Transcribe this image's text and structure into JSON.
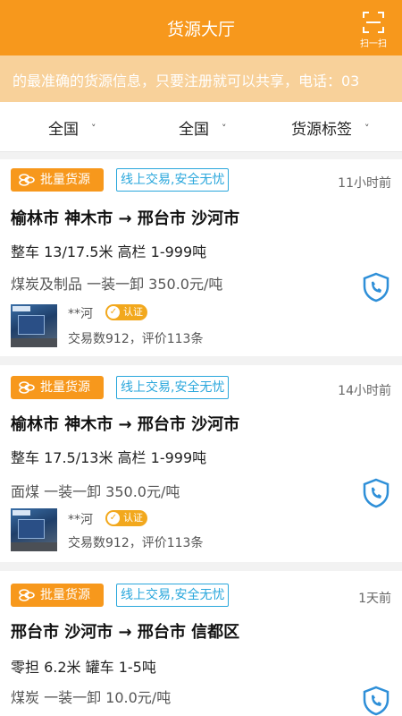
{
  "header": {
    "title": "货源大厅",
    "scan_label": "扫一扫"
  },
  "notice": "的最准确的货源信息，只要注册就可以共享，电话：03",
  "filters": [
    {
      "label": "全国"
    },
    {
      "label": "全国"
    },
    {
      "label": "货源标签"
    }
  ],
  "colors": {
    "primary": "#f7981c",
    "notice_bg": "#f8d19a",
    "safe_blue": "#2aa7dc",
    "verified": "#f2a81d"
  },
  "icons": {
    "scan": "scan-icon",
    "batch": "coins-stack-icon",
    "phone": "phone-shield-icon",
    "verified": "check-circle-icon"
  },
  "cards": [
    {
      "badge": "批量货源",
      "tag": "线上交易,安全无忧",
      "time": "11小时前",
      "route": "榆林市  神木市  →  邢台市  沙河市",
      "spec": "整车   13/17.5米   高栏   1-999吨",
      "goods": "煤炭及制品   一装一卸   350.0元/吨",
      "user": "**河",
      "verified": "认证",
      "stats": "交易数912，评价113条"
    },
    {
      "badge": "批量货源",
      "tag": "线上交易,安全无忧",
      "time": "14小时前",
      "route": "榆林市  神木市  →  邢台市  沙河市",
      "spec": "整车   17.5/13米   高栏   1-999吨",
      "goods": "面煤   一装一卸   350.0元/吨",
      "user": "**河",
      "verified": "认证",
      "stats": "交易数912，评价113条"
    },
    {
      "badge": "批量货源",
      "tag": "线上交易,安全无忧",
      "time": "1天前",
      "route": "邢台市  沙河市  →  邢台市  信都区",
      "spec": "零担   6.2米   罐车   1-5吨",
      "goods": "煤炭   一装一卸   10.0元/吨"
    }
  ]
}
